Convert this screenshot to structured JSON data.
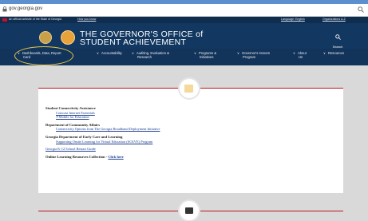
{
  "browser": {
    "url": "gov.georgia.gov"
  },
  "gov_strip": {
    "official_text": "An official website of the State of Georgia",
    "how_you_know": "How you know",
    "language": "Language: English",
    "organizations": "Organizations A-Z"
  },
  "header": {
    "title_line1": "THE GOVERNOR'S OFFICE of",
    "title_line2": "STUDENT ACHIEVEMENT",
    "search_label": "Search"
  },
  "nav": {
    "items": [
      {
        "label_line1": "Dashboards, Data, Report",
        "label_line2": "Card"
      },
      {
        "label_line1": "Accountability",
        "label_line2": ""
      },
      {
        "label_line1": "Auditing, Evaluation &",
        "label_line2": "Research"
      },
      {
        "label_line1": "Programs &",
        "label_line2": "Initiatives"
      },
      {
        "label_line1": "Governor's Honors",
        "label_line2": "Program"
      },
      {
        "label_line1": "About",
        "label_line2": "Us"
      },
      {
        "label_line1": "Resources",
        "label_line2": ""
      }
    ]
  },
  "content": {
    "section1_heading": "Student Connectivity Assistance",
    "section1_links": [
      "Comcast Internet Essentials",
      "T-Mobile for Education"
    ],
    "section2_heading": "Department of Community Affairs",
    "section2_links": [
      "Connectivity Options from The Georgia Broadband Deployment Initiative"
    ],
    "section3_heading": "Georgia Department of Early Care and Learning",
    "section3_links": [
      "Supporting Onsite Learning for Virtual Education (SOLVE) Program"
    ],
    "restart_link": "Georgia K-12 School Restart Guide",
    "online_text": "Online Learning Resources Collection - ",
    "online_link": "Click here"
  },
  "colors": {
    "header_bg": "#123760",
    "accent_red": "#b8161f",
    "link": "#1a3d8f",
    "highlight": "#e3c44a"
  }
}
